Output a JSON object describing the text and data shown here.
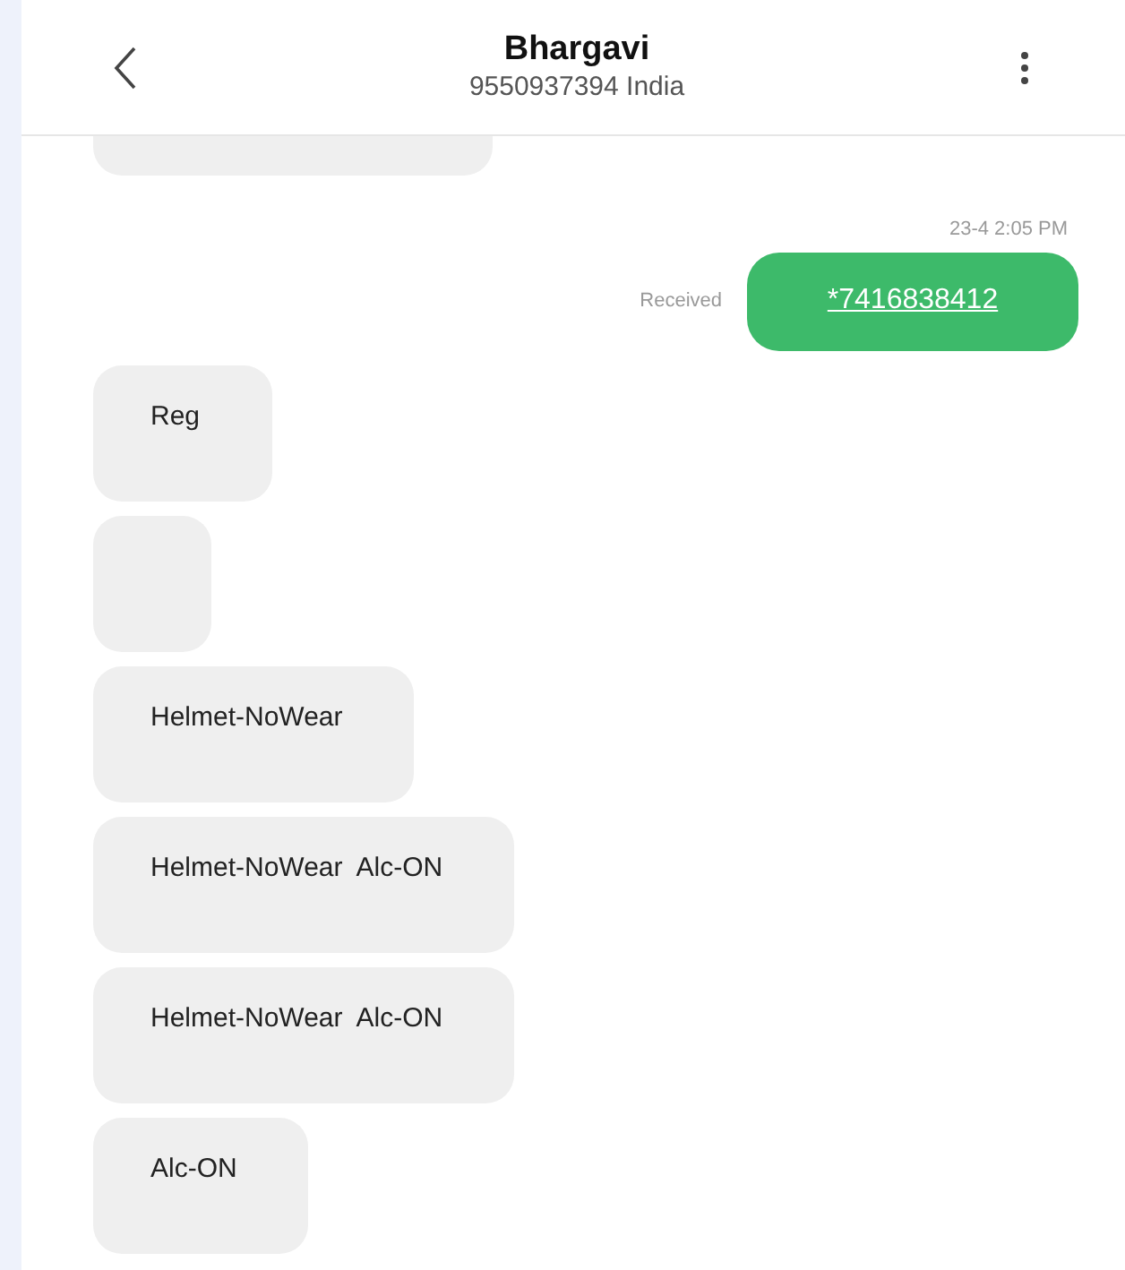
{
  "header": {
    "title": "Bhargavi",
    "subtitle": "9550937394 India"
  },
  "messages": [
    {
      "kind": "incoming",
      "cut": true
    },
    {
      "kind": "outgoing",
      "time": "23-4 2:05 PM",
      "status": "Received",
      "text": "*7416838412"
    },
    {
      "kind": "incoming",
      "text": "Reg"
    },
    {
      "kind": "incoming"
    },
    {
      "kind": "incoming",
      "text": "Helmet-NoWear"
    },
    {
      "kind": "incoming",
      "text": "Helmet-NoWear  Alc-ON"
    },
    {
      "kind": "incoming",
      "text": "Helmet-NoWear  Alc-ON"
    },
    {
      "kind": "incoming",
      "text": "Alc-ON"
    }
  ]
}
